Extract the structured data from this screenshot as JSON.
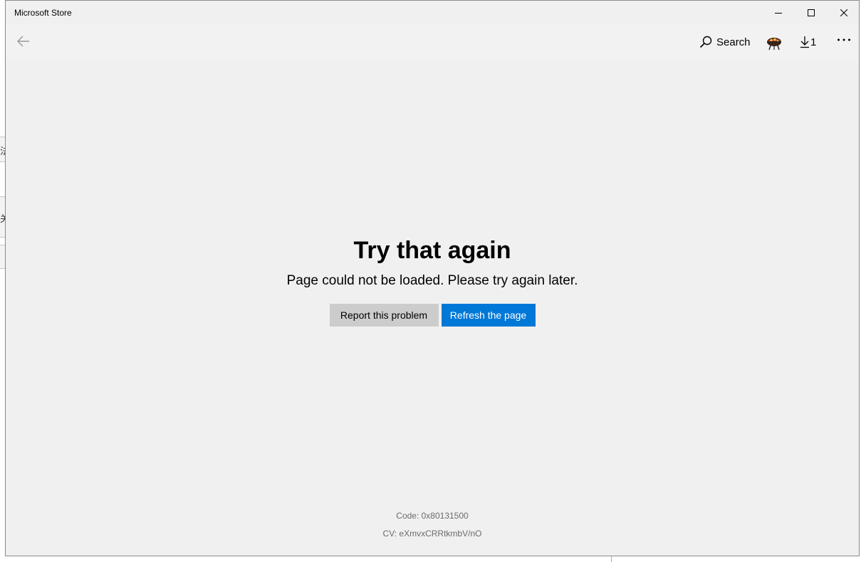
{
  "window": {
    "title": "Microsoft Store",
    "controls": {
      "minimize_icon": "minimize-icon",
      "maximize_icon": "maximize-icon",
      "close_icon": "close-icon"
    }
  },
  "header": {
    "back_icon": "back-arrow-icon",
    "search_label": "Search",
    "avatar_icon": "grill-avatar-icon",
    "downloads_count": "1",
    "more_icon": "more-icon"
  },
  "error": {
    "title": "Try that again",
    "message": "Page could not be loaded. Please try again later.",
    "report_button": "Report this problem",
    "refresh_button": "Refresh the page",
    "code": "Code: 0x80131500",
    "cv": "CV: eXmvxCRRtkmbV/nO"
  },
  "background": {
    "sliver_chars": [
      "法",
      "关"
    ]
  },
  "colors": {
    "accent": "#0078d7",
    "secondary_button": "#cccccc",
    "page_background": "#f0f0f0",
    "muted_text": "#6b6b6b"
  }
}
